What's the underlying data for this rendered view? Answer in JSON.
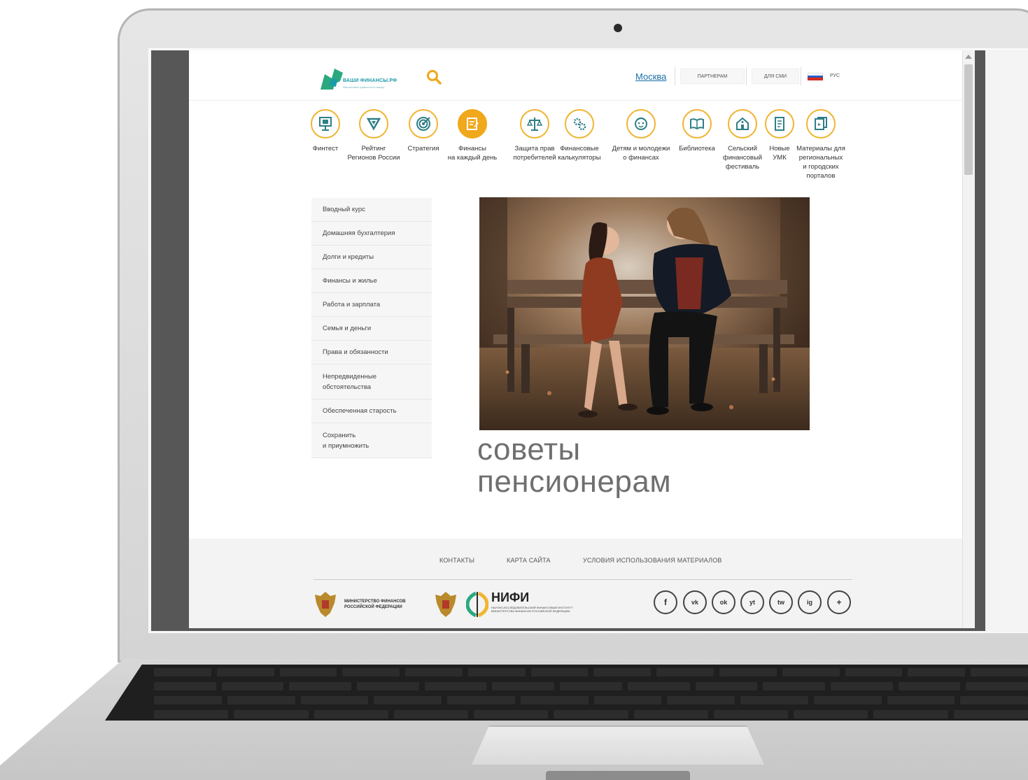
{
  "site": {
    "logo_text": "ВАШИ ФИНАНСЫ.РФ",
    "logo_subtext": "Финансовая грамотность вокруг"
  },
  "header": {
    "city": "Москва",
    "partners_label": "ПАРТНЕРАМ",
    "media_label": "ДЛЯ СМИ",
    "language_label": "РУС"
  },
  "categories": [
    {
      "label": "Финтест",
      "icon": "monitor-icon"
    },
    {
      "label": "Рейтинг\nРегионов России",
      "icon": "triangle-icon"
    },
    {
      "label": "Стратегия",
      "icon": "target-icon"
    },
    {
      "label": "Финансы\nна каждый день",
      "icon": "notebook-icon",
      "active": true
    },
    {
      "label": "Защита прав\nпотребителей",
      "icon": "scales-icon"
    },
    {
      "label": "Финансовые\nкалькуляторы",
      "icon": "gears-icon"
    },
    {
      "label": "Детям и молодежи\nо финансах",
      "icon": "child-icon"
    },
    {
      "label": "Библиотека",
      "icon": "book-icon"
    },
    {
      "label": "Сельский\nфинансовый\nфестиваль",
      "icon": "house-icon"
    },
    {
      "label": "Новые\nУМК",
      "icon": "document-icon"
    },
    {
      "label": "Материалы для\nрегиональных\nи городских\nпорталов",
      "icon": "files-icon"
    }
  ],
  "sidebar": {
    "items": [
      "Вводный курс",
      "Домашняя бухгалтерия",
      "Долги и кредиты",
      "Финансы и жилье",
      "Работа и зарплата",
      "Семья и деньги",
      "Права и обязанности",
      "Непредвиденные\nобстоятельства",
      "Обеспеченная старость",
      "Сохранить\nи приумножить"
    ]
  },
  "main": {
    "headline_line1": "советы",
    "headline_line2": "пенсионерам"
  },
  "footer": {
    "links": [
      "КОНТАКТЫ",
      "КАРТА САЙТА",
      "УСЛОВИЯ ИСПОЛЬЗОВАНИЯ МАТЕРИАЛОВ"
    ],
    "ministry_text": "МИНИСТЕРСТВО ФИНАНСОВ\nРОССИЙСКОЙ ФЕДЕРАЦИИ",
    "nifi_title": "НИФИ",
    "nifi_subtitle": "НАУЧНО-ИССЛЕДОВАТЕЛЬСКИЙ ФИНАНСОВЫЙ ИНСТИТУТ\nМИНИСТЕРСТВА ФИНАНСОВ РОССИЙСКОЙ ФЕДЕРАЦИИ",
    "social": [
      {
        "name": "facebook-icon",
        "glyph": "f"
      },
      {
        "name": "vk-icon",
        "glyph": "vk"
      },
      {
        "name": "odnoklassniki-icon",
        "glyph": "ok"
      },
      {
        "name": "youtube-icon",
        "glyph": "yt"
      },
      {
        "name": "twitter-icon",
        "glyph": "tw"
      },
      {
        "name": "instagram-icon",
        "glyph": "ig"
      },
      {
        "name": "plus-icon",
        "glyph": "+"
      }
    ]
  },
  "colors": {
    "accent": "#f0b532",
    "active": "#f0a81c",
    "brand": "#1b9aa8",
    "link": "#1b6fa8"
  }
}
